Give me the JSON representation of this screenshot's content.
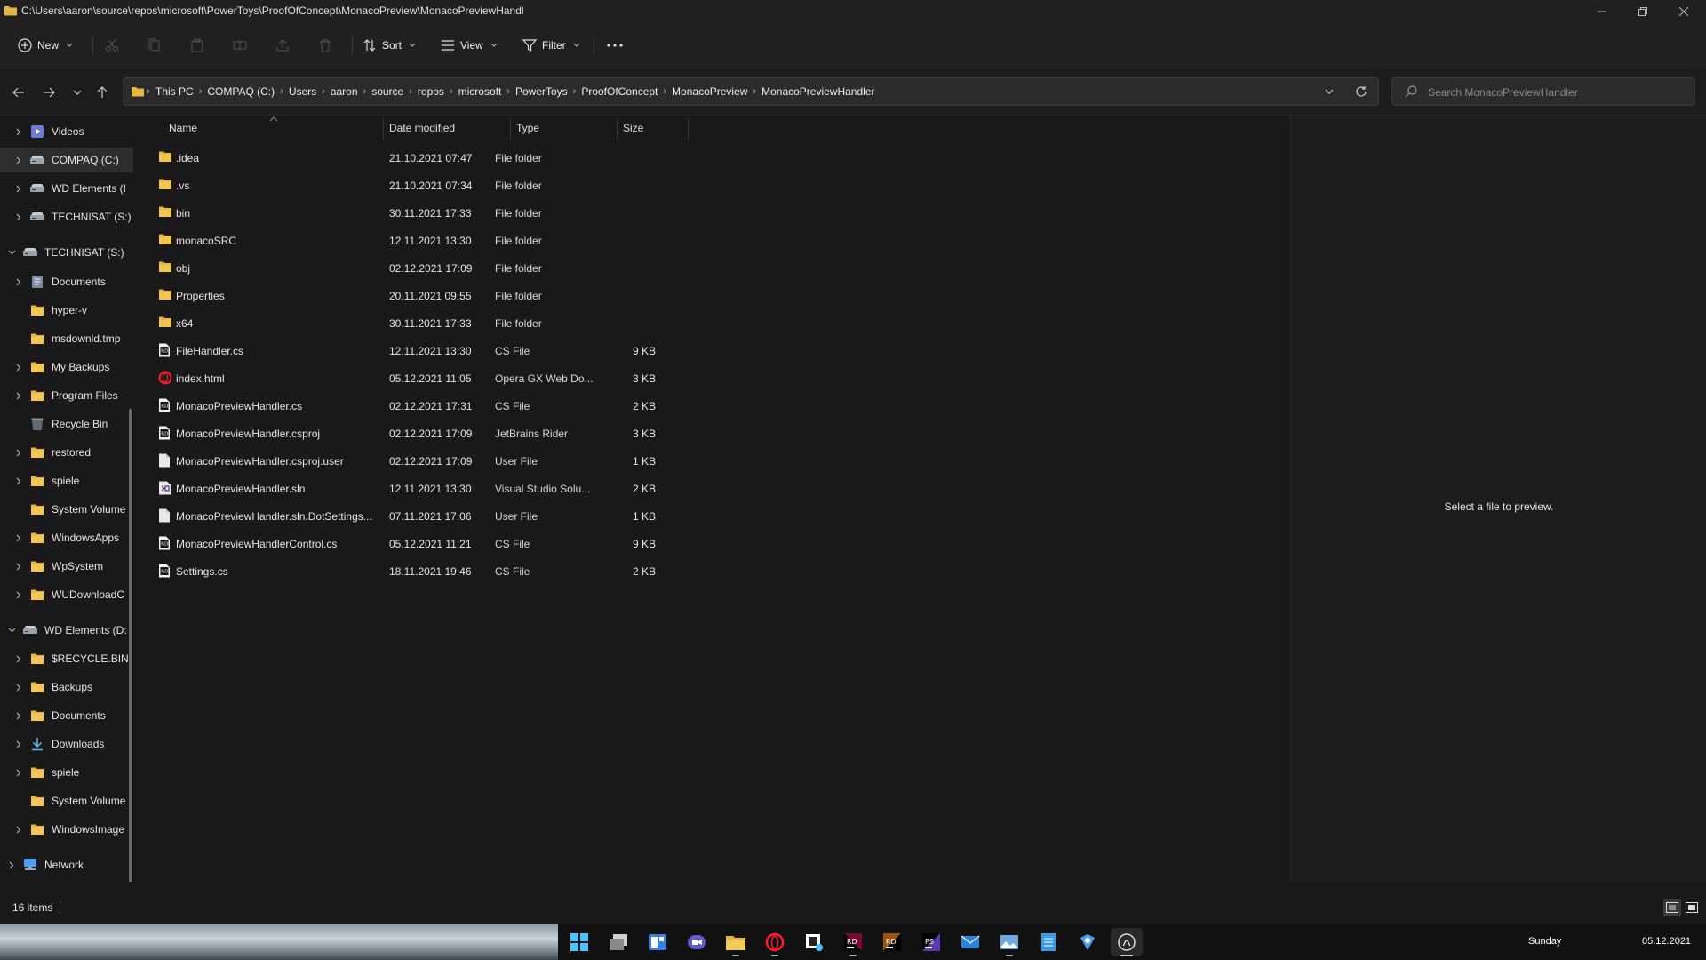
{
  "window": {
    "title_path": "C:\\Users\\aaron\\source\\repos\\microsoft\\PowerToys\\ProofOfConcept\\MonacoPreview\\MonacoPreviewHandl"
  },
  "toolbar": {
    "new_label": "New",
    "sort_label": "Sort",
    "view_label": "View",
    "filter_label": "Filter"
  },
  "address": {
    "crumbs": [
      "This PC",
      "COMPAQ (C:)",
      "Users",
      "aaron",
      "source",
      "repos",
      "microsoft",
      "PowerToys",
      "ProofOfConcept",
      "MonacoPreview",
      "MonacoPreviewHandler"
    ]
  },
  "search": {
    "placeholder": "Search MonacoPreviewHandler"
  },
  "sidebar": {
    "items": [
      {
        "label": "Videos",
        "icon": "videos-icon"
      },
      {
        "label": "COMPAQ (C:)",
        "icon": "drive-icon"
      },
      {
        "label": "WD Elements (I",
        "icon": "drive-icon"
      },
      {
        "label": "TECHNISAT (S:)",
        "icon": "drive-icon"
      },
      {
        "label": "TECHNISAT (S:)",
        "icon": "drive-icon"
      },
      {
        "label": "Documents",
        "icon": "documents-icon"
      },
      {
        "label": "hyper-v",
        "icon": "folder-icon"
      },
      {
        "label": "msdownld.tmp",
        "icon": "folder-icon"
      },
      {
        "label": "My Backups",
        "icon": "folder-icon"
      },
      {
        "label": "Program Files",
        "icon": "folder-icon"
      },
      {
        "label": "Recycle Bin",
        "icon": "recycle-bin-icon"
      },
      {
        "label": "restored",
        "icon": "folder-icon"
      },
      {
        "label": "spiele",
        "icon": "folder-icon"
      },
      {
        "label": "System Volume",
        "icon": "folder-icon"
      },
      {
        "label": "WindowsApps",
        "icon": "folder-icon"
      },
      {
        "label": "WpSystem",
        "icon": "folder-icon"
      },
      {
        "label": "WUDownloadC",
        "icon": "folder-icon"
      },
      {
        "label": "WD Elements (D:",
        "icon": "drive-icon"
      },
      {
        "label": "$RECYCLE.BIN",
        "icon": "folder-icon"
      },
      {
        "label": "Backups",
        "icon": "folder-icon"
      },
      {
        "label": "Documents",
        "icon": "folder-icon"
      },
      {
        "label": "Downloads",
        "icon": "downloads-icon"
      },
      {
        "label": "spiele",
        "icon": "folder-icon"
      },
      {
        "label": "System Volume",
        "icon": "folder-icon"
      },
      {
        "label": "WindowsImage",
        "icon": "folder-icon"
      },
      {
        "label": "Network",
        "icon": "network-icon"
      }
    ]
  },
  "columns": {
    "name": "Name",
    "date": "Date modified",
    "type": "Type",
    "size": "Size"
  },
  "files": [
    {
      "name": ".idea",
      "date": "21.10.2021 07:47",
      "type": "File folder",
      "size": "",
      "icon": "folder"
    },
    {
      "name": ".vs",
      "date": "21.10.2021 07:34",
      "type": "File folder",
      "size": "",
      "icon": "folder"
    },
    {
      "name": "bin",
      "date": "30.11.2021 17:33",
      "type": "File folder",
      "size": "",
      "icon": "folder"
    },
    {
      "name": "monacoSRC",
      "date": "12.11.2021 13:30",
      "type": "File folder",
      "size": "",
      "icon": "folder"
    },
    {
      "name": "obj",
      "date": "02.12.2021 17:09",
      "type": "File folder",
      "size": "",
      "icon": "folder"
    },
    {
      "name": "Properties",
      "date": "20.11.2021 09:55",
      "type": "File folder",
      "size": "",
      "icon": "folder"
    },
    {
      "name": "x64",
      "date": "30.11.2021 17:33",
      "type": "File folder",
      "size": "",
      "icon": "folder"
    },
    {
      "name": "FileHandler.cs",
      "date": "12.11.2021 13:30",
      "type": "CS File",
      "size": "9 KB",
      "icon": "rider"
    },
    {
      "name": "index.html",
      "date": "05.12.2021 11:05",
      "type": "Opera GX Web Do...",
      "size": "3 KB",
      "icon": "opera"
    },
    {
      "name": "MonacoPreviewHandler.cs",
      "date": "02.12.2021 17:31",
      "type": "CS File",
      "size": "2 KB",
      "icon": "rider"
    },
    {
      "name": "MonacoPreviewHandler.csproj",
      "date": "02.12.2021 17:09",
      "type": "JetBrains Rider",
      "size": "3 KB",
      "icon": "rider"
    },
    {
      "name": "MonacoPreviewHandler.csproj.user",
      "date": "02.12.2021 17:09",
      "type": "User File",
      "size": "1 KB",
      "icon": "file"
    },
    {
      "name": "MonacoPreviewHandler.sln",
      "date": "12.11.2021 13:30",
      "type": "Visual Studio Solu...",
      "size": "2 KB",
      "icon": "sln"
    },
    {
      "name": "MonacoPreviewHandler.sln.DotSettings....",
      "date": "07.11.2021 17:06",
      "type": "User File",
      "size": "1 KB",
      "icon": "file"
    },
    {
      "name": "MonacoPreviewHandlerControl.cs",
      "date": "05.12.2021 11:21",
      "type": "CS File",
      "size": "9 KB",
      "icon": "rider"
    },
    {
      "name": "Settings.cs",
      "date": "18.11.2021 19:46",
      "type": "CS File",
      "size": "2 KB",
      "icon": "rider"
    }
  ],
  "preview": {
    "message": "Select a file to preview."
  },
  "status": {
    "item_count": "16 items"
  },
  "taskbar": {
    "day": "Sunday",
    "date": "05.12.2021"
  },
  "colors": {
    "folder": "#e8b640",
    "background": "#191919",
    "opera": "#ff1b2d"
  }
}
